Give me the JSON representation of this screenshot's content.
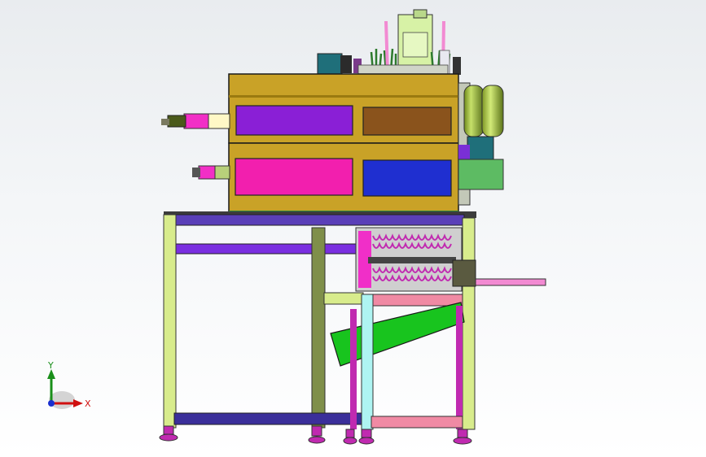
{
  "view": {
    "background_top": "#e9ecef",
    "background_bottom": "#ffffff"
  },
  "triad": {
    "x_label": "X",
    "y_label": "Y",
    "x_color": "#d01010",
    "y_color": "#1a8f1a",
    "z_color": "#1a2fd0"
  },
  "colors": {
    "frame_leg": "#d8ec8c",
    "frame_beam": "#5a3fb8",
    "frame_inner_beam": "#7f8f4a",
    "housing": "#c9a227",
    "panel_purple": "#8a1fd6",
    "panel_brown": "#8a531c",
    "panel_magenta": "#f21fae",
    "panel_blue": "#1f2fd0",
    "motor_green": "#a8c43c",
    "green_box": "#5dbb63",
    "chute_green": "#18c41e",
    "cyan_leg": "#aef4f2",
    "pink_bar": "#f08aa4",
    "pink_shaft": "#f28ad2",
    "coil_magenta": "#c02ab0",
    "dark_motor": "#1f6f7a"
  }
}
